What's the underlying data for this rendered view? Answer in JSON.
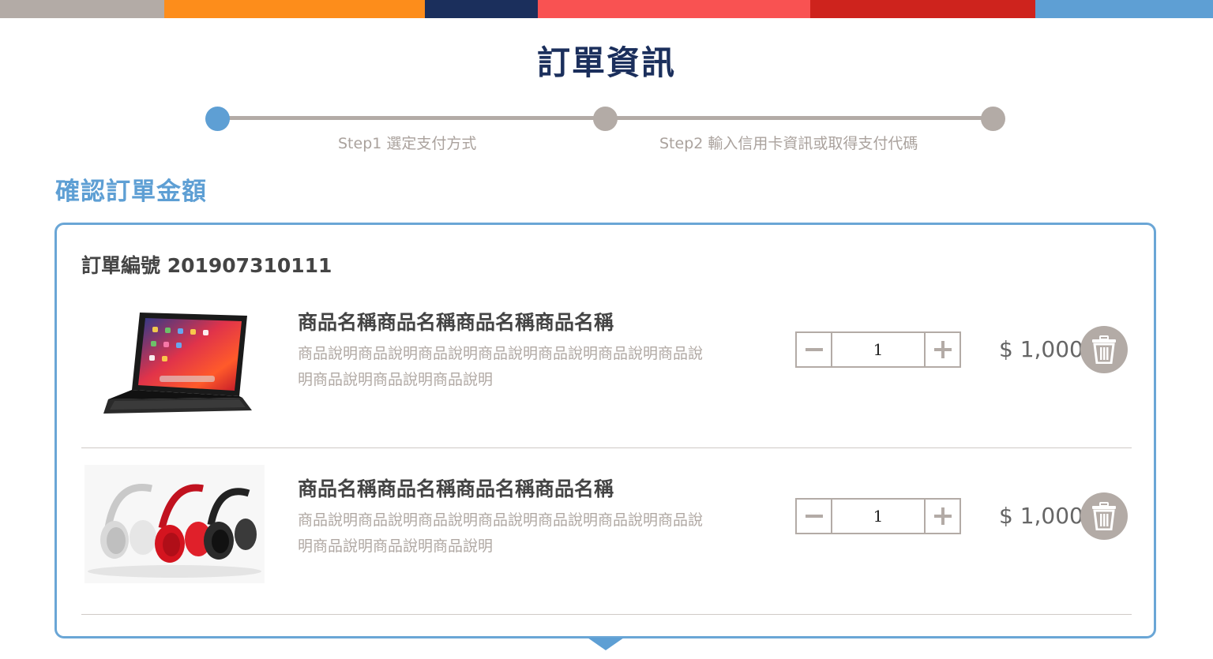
{
  "top_bar": {
    "segments": [
      {
        "color": "#b3aba6"
      },
      {
        "color": "#fd8d1b"
      },
      {
        "color": "#1b2f5c"
      },
      {
        "color": "#f95252"
      },
      {
        "color": "#ce231d"
      },
      {
        "color": "#5e9fd4"
      }
    ]
  },
  "page_title": "訂單資訊",
  "steps": [
    {
      "label": "Step1 選定支付方式"
    },
    {
      "label": "Step2 輸入信用卡資訊或取得支付代碼"
    }
  ],
  "section_title": "確認訂單金額",
  "order": {
    "number_label": "訂單編號 201907310111",
    "items": [
      {
        "image": "tablet-with-keyboard",
        "name": "商品名稱商品名稱商品名稱商品名稱",
        "description": "商品說明商品說明商品說明商品說明商品說明商品說明商品說明商品說明商品說明商品說明",
        "quantity": "1",
        "price": "$ 1,000"
      },
      {
        "image": "headphones",
        "name": "商品名稱商品名稱商品名稱商品名稱",
        "description": "商品說明商品說明商品說明商品說明商品說明商品說明商品說明商品說明商品說明商品說明",
        "quantity": "1",
        "price": "$ 1,000"
      }
    ]
  },
  "colors": {
    "accent": "#5e9fd4",
    "navy": "#1b2f5c",
    "gray": "#b3aba6"
  },
  "icons": [
    "minus-icon",
    "plus-icon",
    "trash-icon",
    "chevron-down-icon"
  ]
}
